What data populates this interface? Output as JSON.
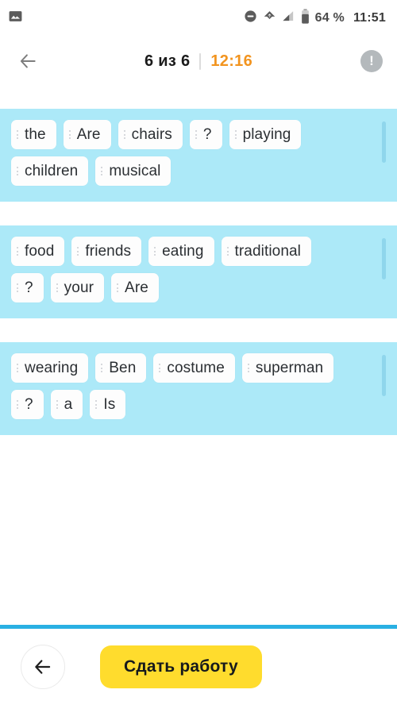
{
  "statusbar": {
    "left_icons": [
      {
        "name": "image-notification-icon"
      }
    ],
    "right_icons": [
      {
        "name": "do-not-disturb-icon"
      },
      {
        "name": "wifi-off-icon"
      },
      {
        "name": "cellular-signal-icon"
      },
      {
        "name": "battery-icon"
      }
    ],
    "battery_text": "64 %",
    "clock_text": "11:51"
  },
  "header": {
    "back_icon": "arrow-left-icon",
    "progress_text": "6 из 6",
    "timer_text": "12:16",
    "info_icon": "exclamation-circle-icon",
    "info_glyph": "!"
  },
  "cards": [
    {
      "id": "task-1",
      "chips": [
        "the",
        "Are",
        "chairs",
        "?",
        "playing",
        "children",
        "musical"
      ]
    },
    {
      "id": "task-2",
      "chips": [
        "food",
        "friends",
        "eating",
        "traditional",
        "?",
        "your",
        "Are"
      ]
    },
    {
      "id": "task-3",
      "chips": [
        "wearing",
        "Ben",
        "costume",
        "superman",
        "?",
        "a",
        "Is"
      ]
    }
  ],
  "footer": {
    "back_icon": "arrow-left-icon",
    "submit_label": "Сдать работу"
  },
  "colors": {
    "card_background": "#ace9f8",
    "chip_background": "#fdfdfd",
    "timer_accent": "#f2941f",
    "submit_accent": "#ffdc2d",
    "divider_accent": "#29b0e3"
  }
}
